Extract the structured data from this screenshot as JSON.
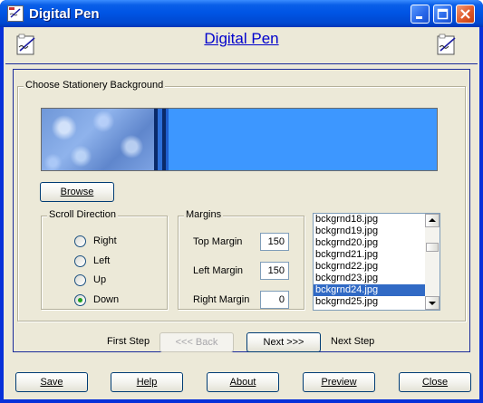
{
  "window": {
    "title": "Digital Pen"
  },
  "header": {
    "title": "Digital Pen"
  },
  "stationery": {
    "group_label": "Choose Stationery Background",
    "browse_label": "Browse"
  },
  "scroll_direction": {
    "label": "Scroll Direction",
    "options": [
      "Right",
      "Left",
      "Up",
      "Down"
    ],
    "selected": "Down"
  },
  "margins": {
    "label": "Margins",
    "top_label": "Top Margin",
    "top_value": "150",
    "left_label": "Left Margin",
    "left_value": "150",
    "right_label": "Right Margin",
    "right_value": "0"
  },
  "backgrounds": {
    "items": [
      "bckgrnd18.jpg",
      "bckgrnd19.jpg",
      "bckgrnd20.jpg",
      "bckgrnd21.jpg",
      "bckgrnd22.jpg",
      "bckgrnd23.jpg",
      "bckgrnd24.jpg",
      "bckgrnd25.jpg"
    ],
    "selected": "bckgrnd24.jpg"
  },
  "wizard": {
    "first_step": "First Step",
    "back_label": "<<< Back",
    "next_label": "Next >>>",
    "next_step": "Next Step"
  },
  "footer": {
    "save": "Save",
    "help": "Help",
    "about": "About",
    "preview": "Preview",
    "close": "Close"
  },
  "colors": {
    "titlebar": "#0055e5",
    "client": "#ece9d8",
    "link": "#0000cc",
    "selection": "#316ac5",
    "preview_blue": "#3d97ff"
  }
}
